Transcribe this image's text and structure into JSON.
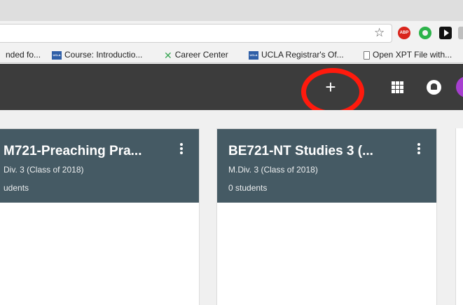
{
  "browser": {
    "extensions": [
      {
        "name": "adblock-icon",
        "label": "ABP"
      },
      {
        "name": "green-circle-icon"
      },
      {
        "name": "play-icon"
      }
    ],
    "bookmarks": [
      {
        "label": "nded fo...",
        "icon": "bookmark-favicon"
      },
      {
        "label": "Course: Introductio...",
        "icon": "ucla-favicon",
        "icon_text": "UCLA"
      },
      {
        "label": "Career Center",
        "icon": "career-center-icon"
      },
      {
        "label": "UCLA Registrar's Of...",
        "icon": "ucla-favicon",
        "icon_text": "UCLA"
      },
      {
        "label": "Open XPT File with...",
        "icon": "file-icon"
      }
    ]
  },
  "header": {
    "create_label": "+",
    "highlight_color": "#ff1a0d",
    "background": "#3c3c3c"
  },
  "cards": [
    {
      "title": "M721-Preaching Pra...",
      "subtitle": "Div. 3 (Class of 2018)",
      "count": "udents"
    },
    {
      "title": "BE721-NT Studies 3 (...",
      "subtitle": "M.Div. 3 (Class of 2018)",
      "count": "0 students"
    }
  ],
  "colors": {
    "card_header": "#455a64",
    "avatar": "#a63fcf"
  }
}
